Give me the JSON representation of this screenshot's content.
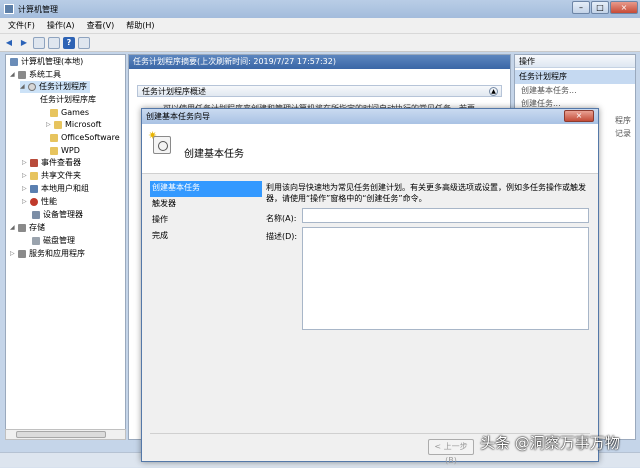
{
  "window": {
    "title": "计算机管理"
  },
  "menu": [
    "文件(F)",
    "操作(A)",
    "查看(V)",
    "帮助(H)"
  ],
  "tree": {
    "root": "计算机管理(本地)",
    "system_tools": "系统工具",
    "task_scheduler": "任务计划程序",
    "task_library": "任务计划程序库",
    "games": "Games",
    "microsoft": "Microsoft",
    "office": "OfficeSoftware",
    "wpd": "WPD",
    "event_viewer": "事件查看器",
    "shared_folders": "共享文件夹",
    "local_users": "本地用户和组",
    "performance": "性能",
    "device_manager": "设备管理器",
    "storage": "存储",
    "disk_mgmt": "磁盘管理",
    "services": "服务和应用程序"
  },
  "center": {
    "header": "任务计划程序摘要(上次刷新时间: 2019/7/27 17:57:32)",
    "section": "任务计划程序概述",
    "bgtext": "可以使用任务计划程序来创建和管理计算机将在所指定的时间自动执行的常见任务。若要"
  },
  "actions": {
    "title": "操作",
    "group": "任务计划程序",
    "items": [
      "创建基本任务...",
      "创建任务...",
      "程序",
      "记录"
    ]
  },
  "dialog": {
    "title": "创建基本任务向导",
    "heading": "创建基本任务",
    "close": "×",
    "steps": [
      "创建基本任务",
      "触发器",
      "操作",
      "完成"
    ],
    "description": "利用该向导快速地为常见任务创建计划。有关更多高级选项或设置，例如多任务操作或触发器，请使用“操作”窗格中的“创建任务”命令。",
    "name_label": "名称(A):",
    "name_value": "",
    "desc_label": "描述(D):",
    "desc_value": "",
    "prev_button": "< 上一步(B)"
  },
  "watermark": "头条 @洞察万事万物"
}
